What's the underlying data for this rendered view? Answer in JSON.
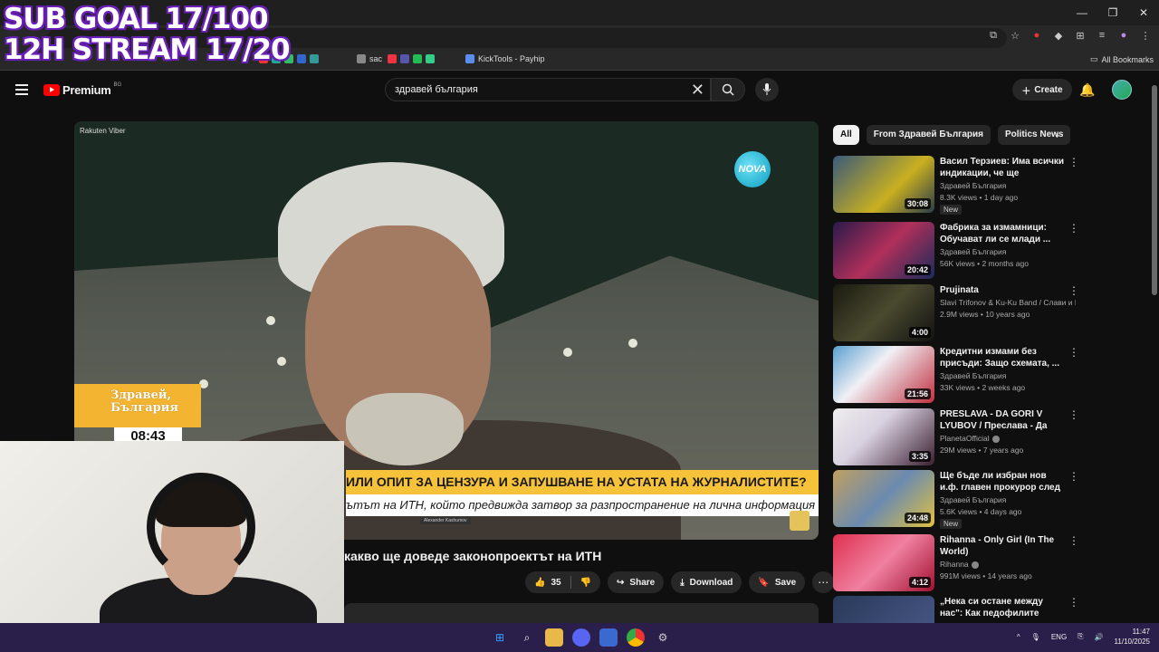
{
  "browser": {
    "bookmarks": [
      {
        "label": "sac",
        "color": "#888888"
      },
      {
        "label": "KickTools - Payhip",
        "color": "#5b8def"
      }
    ],
    "all_bookmarks": "All Bookmarks"
  },
  "overlay": {
    "line1": "SUB GOAL 17/100",
    "line2": "12H STREAM 17/20"
  },
  "youtube": {
    "logo": "Premium",
    "logo_region": "BG",
    "search_value": "здравей българия",
    "create_label": "Create"
  },
  "video": {
    "watermark": "Rakuten Viber",
    "channel_logo": "NOVA",
    "show_name_1": "Здравей,",
    "show_name_2": "България",
    "clock": "08:43",
    "headline": "ИЛИ ОПИТ ЗА ЦЕНЗУРА И ЗАПУШВАНЕ НА УСТАТА НА ЖУРНАЛИСТИТЕ?",
    "subline": "ътът на ИТН, който предвижда затвор за разпространение на лична информация в медиите?",
    "caption_name": "Alexander Kashumov",
    "title": "какво ще доведе законопроектът на ИТН"
  },
  "actions": {
    "likes": "35",
    "share": "Share",
    "download": "Download",
    "save": "Save"
  },
  "chips": [
    "All",
    "From Здравей България",
    "Politics News"
  ],
  "recommendations": [
    {
      "title": "Васил Терзиев: Има всички индикации, че ще подпишем...",
      "channel": "Здравей България",
      "meta": "8.3K views • 1 day ago",
      "badge": "New",
      "duration": "30:08",
      "verified": false
    },
    {
      "title": "Фабрика за измамници: Обучават ли се млади ...",
      "channel": "Здравей България",
      "meta": "56K views • 2 months ago",
      "badge": "",
      "duration": "20:42",
      "verified": false
    },
    {
      "title": "Prujinata",
      "channel": "Slavi Trifonov & Ku-Ku Band / Слави и К...",
      "meta": "2.9M views • 10 years ago",
      "badge": "",
      "duration": "4:00",
      "verified": false
    },
    {
      "title": "Кредитни измами без присъди: Защо схемата, ...",
      "channel": "Здравей България",
      "meta": "33K views • 2 weeks ago",
      "badge": "",
      "duration": "21:56",
      "verified": false
    },
    {
      "title": "PRESLAVA - DA GORI V LYUBOV / Преслава - Да гори в любо...",
      "channel": "PlanetaOfficial",
      "meta": "29M views • 7 years ago",
      "badge": "",
      "duration": "3:35",
      "verified": true
    },
    {
      "title": "Ще бъде ли избран нов и.ф. главен прокурор след ...",
      "channel": "Здравей България",
      "meta": "5.6K views • 4 days ago",
      "badge": "New",
      "duration": "24:48",
      "verified": false
    },
    {
      "title": "Rihanna - Only Girl (In The World)",
      "channel": "Rihanna",
      "meta": "991M views • 14 years ago",
      "badge": "",
      "duration": "4:12",
      "verified": true
    },
    {
      "title": "„Нека си остане между нас\": Как педофилите улавят ...",
      "channel": "",
      "meta": "",
      "badge": "",
      "duration": "",
      "verified": false
    }
  ],
  "taskbar": {
    "lang": "ENG",
    "time": "11:47",
    "date": "11/10/2025"
  }
}
